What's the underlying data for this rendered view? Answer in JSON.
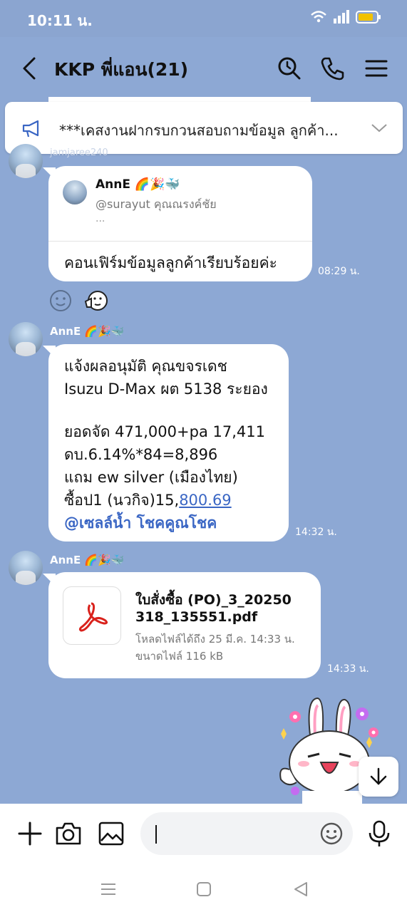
{
  "status": {
    "time": "10:11 น."
  },
  "header": {
    "title": "KKP พี่แอน(21)"
  },
  "announcement": {
    "text": "***เคสงานฝากรบกวนสอบถามข้อมูล ลูกค้า..."
  },
  "messages": [
    {
      "sender": "jamjaree240",
      "reply": {
        "name": "AnnE 🌈🎉🐳",
        "handle": "@surayut คุณณรงค์ชัย",
        "ellipsis": "..."
      },
      "text": "คอนเฟิร์มข้อมูลลูกค้าเรียบร้อยค่ะ",
      "time": "08:29 น."
    },
    {
      "sender": "AnnE 🌈🎉🐳",
      "lines": [
        "แจ้งผลอนุมัติ คุณขจรเดช",
        "Isuzu D-Max ผต 5138 ระยอง",
        "",
        "ยอดจัด 471,000+pa 17,411",
        "ดบ.6.14%*84=8,896",
        "แถม ew silver (เมืองไทย)"
      ],
      "last_line_prefix": "ซื้อป1 (นวกิจ)15,",
      "last_line_link": "800.69",
      "mention": "@เซลล์น้ำ โชคคูณโชค",
      "time": "14:32 น."
    },
    {
      "sender": "AnnE 🌈🎉🐳",
      "file_name_1": "ใบสั่งซื้อ (PO)_3_20250",
      "file_name_2": "318_135551.pdf",
      "file_expiry": "โหลดไฟล์ได้ถึง 25 มี.ค. 14:33 น.",
      "file_size": "ขนาดไฟล์ 116 kB",
      "time": "14:33 น."
    }
  ],
  "composer": {
    "placeholder": ""
  },
  "colors": {
    "background": "#8da8d4",
    "link": "#3a66c4",
    "pdf_red": "#d9221c"
  }
}
